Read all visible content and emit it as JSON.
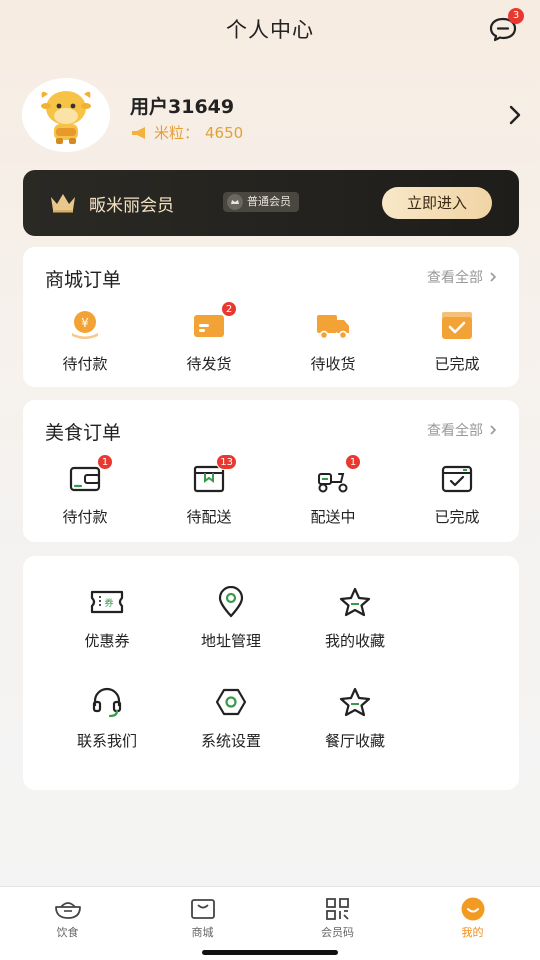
{
  "header": {
    "title": "个人中心",
    "message_badge": "3"
  },
  "profile": {
    "username": "用户31649",
    "points_label": "米粒：",
    "points_value": "4650"
  },
  "vip": {
    "title": "畈米丽会员",
    "level": "普通会员",
    "enter_label": "立即进入"
  },
  "mall_orders": {
    "title": "商城订单",
    "view_all": "查看全部",
    "items": [
      {
        "label": "待付款",
        "badge": ""
      },
      {
        "label": "待发货",
        "badge": "2"
      },
      {
        "label": "待收货",
        "badge": ""
      },
      {
        "label": "已完成",
        "badge": ""
      }
    ]
  },
  "food_orders": {
    "title": "美食订单",
    "view_all": "查看全部",
    "items": [
      {
        "label": "待付款",
        "badge": "1"
      },
      {
        "label": "待配送",
        "badge": "13"
      },
      {
        "label": "配送中",
        "badge": "1"
      },
      {
        "label": "已完成",
        "badge": ""
      }
    ]
  },
  "services": {
    "items": [
      {
        "label": "优惠券",
        "icon": "coupon-icon"
      },
      {
        "label": "地址管理",
        "icon": "location-icon"
      },
      {
        "label": "我的收藏",
        "icon": "star-icon"
      },
      {
        "label": "联系我们",
        "icon": "headset-icon"
      },
      {
        "label": "系统设置",
        "icon": "settings-icon"
      },
      {
        "label": "餐厅收藏",
        "icon": "star-icon"
      }
    ]
  },
  "tabbar": {
    "items": [
      {
        "label": "饮食",
        "icon": "food-icon"
      },
      {
        "label": "商城",
        "icon": "mall-icon"
      },
      {
        "label": "会员码",
        "icon": "member-code-icon"
      },
      {
        "label": "我的",
        "icon": "profile-icon"
      }
    ],
    "active_index": 3
  },
  "colors": {
    "accent": "#f08c1c",
    "badge": "#e8382f",
    "icon_green": "#3a9a4c",
    "vip_bg": "#25231f"
  }
}
